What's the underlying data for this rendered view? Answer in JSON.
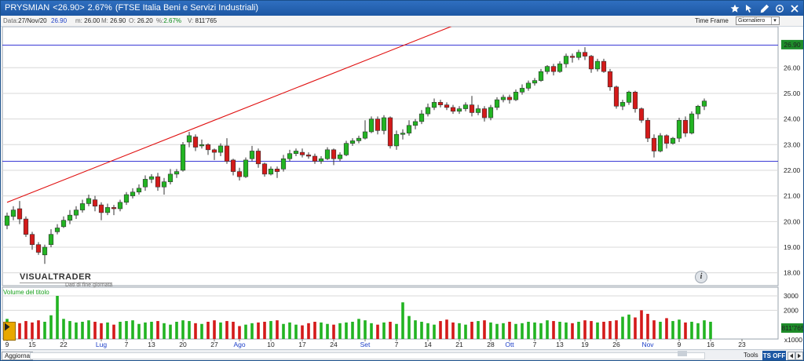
{
  "titlebar": {
    "symbol": "PRYSMIAN",
    "price_badge": "<26.90>",
    "change": "2.67%",
    "index_name": "(FTSE Italia Beni e Servizi Industriali)",
    "icons": [
      "star-icon",
      "cursor-arrow-icon",
      "pencil-icon",
      "crosshair-icon",
      "close-icon"
    ]
  },
  "quote": {
    "date_label": "Data:",
    "date_value": "27/Nov/20",
    "last_value": "26.90",
    "min_label": "m:",
    "min_value": "26.00",
    "max_label": "M:",
    "max_value": "26.90",
    "open_label": "O:",
    "open_value": "26.20",
    "pct_label": "%:",
    "pct_value": "2.67%",
    "volume_label": "V:",
    "volume_value": "811'765",
    "timeframe_label": "Time Frame",
    "timeframe_value": "Giornaliero"
  },
  "watermark": {
    "brand": "VISUALTRADER",
    "subtitle": "Dati di fine giornata"
  },
  "info_button_glyph": "i",
  "volume_panel": {
    "label": "Volume del titolo"
  },
  "bottombar": {
    "refresh_label": "Aggiorna",
    "tools_label": "Tools",
    "tsoff_label": "TS OFF"
  },
  "colors": {
    "up": "#22b422",
    "down": "#d41a1a",
    "reference_line": "#3a3ad6",
    "trend_line": "#e01010",
    "grid": "#d8d8d8",
    "last_price_tag": "#1e8c2a"
  },
  "chart_data": [
    {
      "type": "candlestick",
      "title": "",
      "ylim": [
        17.5,
        27.6
      ],
      "y_ticks": [
        "26.00",
        "25.00",
        "24.00",
        "23.00",
        "22.00",
        "21.00",
        "20.00",
        "19.00",
        "18.00"
      ],
      "last_price_tag": "26.90",
      "x_labels": [
        {
          "text": "9",
          "index": 0,
          "month": false
        },
        {
          "text": "15",
          "index": 4,
          "month": false
        },
        {
          "text": "22",
          "index": 9,
          "month": false
        },
        {
          "text": "Lug",
          "index": 15,
          "month": true
        },
        {
          "text": "7",
          "index": 19,
          "month": false
        },
        {
          "text": "13",
          "index": 23,
          "month": false
        },
        {
          "text": "20",
          "index": 28,
          "month": false
        },
        {
          "text": "27",
          "index": 33,
          "month": false
        },
        {
          "text": "Ago",
          "index": 37,
          "month": true
        },
        {
          "text": "10",
          "index": 42,
          "month": false
        },
        {
          "text": "17",
          "index": 47,
          "month": false
        },
        {
          "text": "24",
          "index": 52,
          "month": false
        },
        {
          "text": "Set",
          "index": 57,
          "month": true
        },
        {
          "text": "7",
          "index": 62,
          "month": false
        },
        {
          "text": "14",
          "index": 67,
          "month": false
        },
        {
          "text": "21",
          "index": 72,
          "month": false
        },
        {
          "text": "28",
          "index": 77,
          "month": false
        },
        {
          "text": "Ott",
          "index": 80,
          "month": true
        },
        {
          "text": "7",
          "index": 84,
          "month": false
        },
        {
          "text": "13",
          "index": 88,
          "month": false
        },
        {
          "text": "19",
          "index": 92,
          "month": false
        },
        {
          "text": "26",
          "index": 97,
          "month": false
        },
        {
          "text": "Nov",
          "index": 102,
          "month": true
        },
        {
          "text": "9",
          "index": 107,
          "month": false
        },
        {
          "text": "16",
          "index": 112,
          "month": false
        },
        {
          "text": "23",
          "index": 117,
          "month": false
        }
      ],
      "reference_lines": [
        26.88,
        22.35
      ],
      "trend_line": {
        "from": {
          "index": 0,
          "price": 20.75
        },
        "to": {
          "index": 76,
          "price": 28.12
        }
      },
      "candles": [
        [
          19.85,
          20.22,
          19.7,
          20.35
        ],
        [
          20.2,
          20.45,
          20.05,
          20.6
        ],
        [
          20.5,
          20.1,
          19.9,
          20.8
        ],
        [
          20.1,
          19.5,
          19.4,
          20.2
        ],
        [
          19.5,
          19.1,
          18.9,
          19.6
        ],
        [
          19.1,
          18.8,
          18.7,
          19.2
        ],
        [
          18.7,
          19.0,
          18.35,
          19.1
        ],
        [
          19.1,
          19.5,
          19.0,
          19.7
        ],
        [
          19.6,
          19.75,
          19.5,
          19.9
        ],
        [
          19.8,
          20.05,
          19.75,
          20.2
        ],
        [
          20.05,
          20.25,
          19.9,
          20.45
        ],
        [
          20.25,
          20.45,
          20.1,
          20.6
        ],
        [
          20.45,
          20.7,
          20.35,
          20.85
        ],
        [
          20.7,
          20.9,
          20.6,
          21.05
        ],
        [
          20.85,
          20.6,
          20.4,
          21.0
        ],
        [
          20.65,
          20.35,
          20.05,
          20.75
        ],
        [
          20.35,
          20.55,
          20.25,
          20.7
        ],
        [
          20.55,
          20.5,
          20.25,
          20.65
        ],
        [
          20.5,
          20.75,
          20.4,
          20.85
        ],
        [
          20.75,
          21.05,
          20.65,
          21.15
        ],
        [
          21.0,
          21.15,
          20.9,
          21.3
        ],
        [
          21.15,
          21.3,
          21.05,
          21.45
        ],
        [
          21.35,
          21.65,
          21.2,
          21.8
        ],
        [
          21.65,
          21.75,
          21.5,
          21.85
        ],
        [
          21.75,
          21.35,
          21.2,
          21.9
        ],
        [
          21.35,
          21.55,
          21.05,
          21.7
        ],
        [
          21.55,
          21.85,
          21.45,
          22.05
        ],
        [
          21.85,
          21.95,
          21.7,
          22.05
        ],
        [
          22.0,
          23.0,
          21.95,
          23.1
        ],
        [
          23.1,
          23.35,
          22.9,
          23.5
        ],
        [
          23.3,
          22.9,
          22.75,
          23.4
        ],
        [
          22.95,
          23.0,
          22.85,
          23.2
        ],
        [
          23.0,
          22.8,
          22.6,
          23.05
        ],
        [
          22.8,
          22.7,
          22.4,
          22.85
        ],
        [
          22.7,
          22.95,
          22.55,
          23.05
        ],
        [
          22.95,
          22.35,
          22.25,
          23.25
        ],
        [
          22.4,
          21.95,
          21.8,
          22.45
        ],
        [
          21.95,
          21.75,
          21.6,
          22.1
        ],
        [
          21.75,
          22.4,
          21.7,
          22.5
        ],
        [
          22.45,
          22.75,
          22.35,
          22.95
        ],
        [
          22.75,
          22.25,
          22.1,
          22.85
        ],
        [
          22.25,
          21.85,
          21.75,
          22.3
        ],
        [
          21.85,
          22.05,
          21.8,
          22.15
        ],
        [
          22.05,
          21.95,
          21.7,
          22.15
        ],
        [
          22.05,
          22.45,
          21.95,
          22.6
        ],
        [
          22.45,
          22.65,
          22.35,
          22.8
        ],
        [
          22.65,
          22.75,
          22.55,
          22.85
        ],
        [
          22.7,
          22.6,
          22.5,
          22.85
        ],
        [
          22.6,
          22.55,
          22.45,
          22.7
        ],
        [
          22.55,
          22.35,
          22.25,
          22.65
        ],
        [
          22.35,
          22.45,
          22.25,
          22.55
        ],
        [
          22.45,
          22.8,
          22.4,
          22.9
        ],
        [
          22.8,
          22.45,
          22.2,
          22.85
        ],
        [
          22.45,
          22.6,
          22.35,
          22.7
        ],
        [
          22.6,
          23.05,
          22.55,
          23.15
        ],
        [
          23.05,
          23.15,
          22.95,
          23.25
        ],
        [
          23.15,
          23.25,
          23.05,
          23.35
        ],
        [
          23.25,
          23.5,
          23.2,
          23.95
        ],
        [
          23.5,
          24.0,
          23.45,
          24.1
        ],
        [
          24.0,
          23.55,
          23.4,
          24.1
        ],
        [
          23.55,
          24.05,
          23.4,
          24.15
        ],
        [
          24.05,
          22.95,
          22.85,
          24.1
        ],
        [
          22.95,
          23.4,
          22.8,
          23.55
        ],
        [
          23.4,
          23.45,
          23.2,
          23.6
        ],
        [
          23.45,
          23.75,
          23.35,
          23.95
        ],
        [
          23.75,
          23.9,
          23.6,
          24.0
        ],
        [
          23.9,
          24.2,
          23.8,
          24.35
        ],
        [
          24.2,
          24.45,
          24.1,
          24.6
        ],
        [
          24.45,
          24.65,
          24.35,
          24.8
        ],
        [
          24.65,
          24.55,
          24.45,
          24.75
        ],
        [
          24.55,
          24.45,
          24.35,
          24.65
        ],
        [
          24.45,
          24.3,
          24.2,
          24.55
        ],
        [
          24.3,
          24.4,
          24.2,
          24.5
        ],
        [
          24.4,
          24.55,
          24.3,
          24.65
        ],
        [
          24.55,
          24.25,
          24.1,
          24.9
        ],
        [
          24.25,
          24.4,
          24.15,
          24.55
        ],
        [
          24.4,
          24.05,
          23.9,
          24.5
        ],
        [
          24.05,
          24.45,
          23.95,
          24.55
        ],
        [
          24.45,
          24.75,
          24.35,
          24.85
        ],
        [
          24.75,
          24.85,
          24.65,
          24.95
        ],
        [
          24.85,
          24.75,
          24.6,
          24.95
        ],
        [
          24.75,
          25.05,
          24.7,
          25.15
        ],
        [
          25.05,
          25.2,
          24.95,
          25.35
        ],
        [
          25.2,
          25.4,
          25.1,
          25.5
        ],
        [
          25.4,
          25.5,
          25.3,
          25.6
        ],
        [
          25.5,
          25.85,
          25.45,
          25.95
        ],
        [
          25.85,
          26.05,
          25.75,
          26.1
        ],
        [
          26.05,
          25.85,
          25.7,
          26.15
        ],
        [
          25.85,
          26.15,
          25.8,
          26.25
        ],
        [
          26.15,
          26.45,
          26.0,
          26.55
        ],
        [
          26.45,
          26.4,
          26.2,
          26.55
        ],
        [
          26.4,
          26.6,
          26.3,
          26.7
        ],
        [
          26.6,
          26.45,
          26.3,
          26.8
        ],
        [
          26.45,
          25.95,
          25.8,
          26.5
        ],
        [
          25.95,
          26.25,
          25.85,
          26.35
        ],
        [
          26.25,
          25.85,
          25.8,
          26.35
        ],
        [
          25.85,
          25.25,
          25.1,
          25.95
        ],
        [
          25.25,
          24.5,
          24.4,
          25.3
        ],
        [
          24.5,
          24.65,
          24.35,
          24.75
        ],
        [
          24.65,
          25.05,
          24.55,
          25.1
        ],
        [
          25.05,
          24.4,
          24.25,
          25.1
        ],
        [
          24.4,
          23.95,
          23.85,
          24.45
        ],
        [
          23.95,
          23.25,
          23.1,
          24.05
        ],
        [
          23.25,
          22.75,
          22.5,
          23.4
        ],
        [
          22.75,
          23.35,
          22.7,
          23.45
        ],
        [
          23.35,
          23.05,
          22.85,
          23.4
        ],
        [
          23.05,
          23.25,
          23.0,
          23.3
        ],
        [
          23.25,
          23.95,
          23.1,
          24.05
        ],
        [
          23.95,
          23.45,
          23.3,
          24.1
        ],
        [
          23.45,
          24.2,
          23.4,
          24.3
        ],
        [
          24.2,
          24.5,
          24.0,
          24.55
        ],
        [
          24.5,
          24.7,
          24.35,
          24.8
        ]
      ]
    },
    {
      "type": "bar",
      "title": "Volume del titolo",
      "y_ticks": [
        "3000",
        "2000"
      ],
      "y_multiplier": "x1000",
      "last_value_tag": "811'765",
      "ylim": [
        0,
        3600
      ],
      "values": [
        1400,
        700,
        1100,
        1250,
        1150,
        1300,
        1200,
        1650,
        3000,
        1400,
        1250,
        1150,
        1200,
        1300,
        1200,
        1100,
        1150,
        1000,
        1200,
        1250,
        1300,
        1050,
        1150,
        1200,
        1250,
        1100,
        1000,
        1200,
        1300,
        1250,
        1100,
        1050,
        1200,
        1300,
        1150,
        1250,
        1200,
        900,
        1000,
        1100,
        1150,
        1200,
        1250,
        1300,
        1050,
        1150,
        1000,
        950,
        1100,
        1200,
        1150,
        1050,
        1000,
        1100,
        1150,
        1200,
        1400,
        1300,
        1100,
        1000,
        1150,
        1200,
        1050,
        2550,
        1600,
        1300,
        1200,
        1100,
        1000,
        1250,
        1350,
        1150,
        1100,
        1000,
        1200,
        1250,
        1300,
        1150,
        1050,
        1100,
        1200,
        1050,
        1100,
        1200,
        1150,
        1100,
        1300,
        1250,
        1200,
        1150,
        1100,
        1200,
        1300,
        1250,
        1150,
        1200,
        1250,
        1300,
        1550,
        1700,
        1500,
        2000,
        1750,
        1300,
        1200,
        1450,
        1250,
        1350,
        1150,
        1200,
        1100,
        1300,
        1200
      ]
    }
  ]
}
